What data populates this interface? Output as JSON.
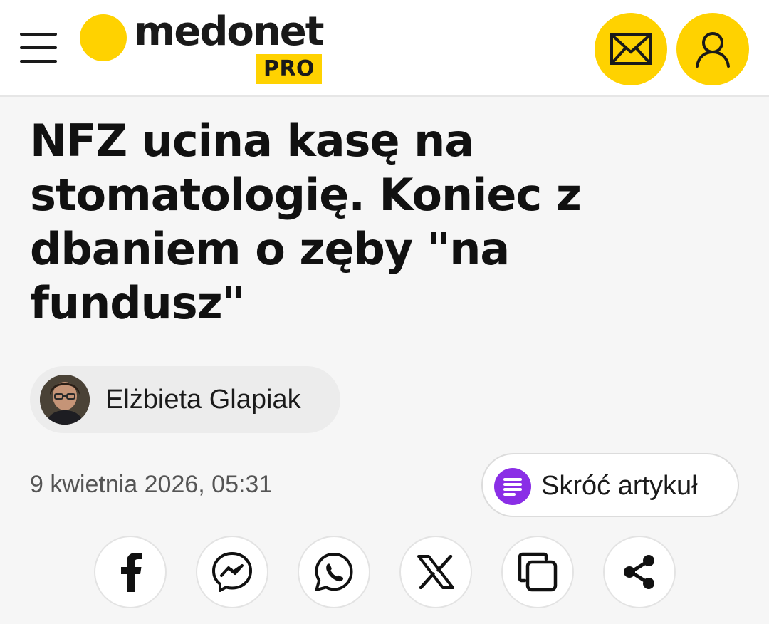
{
  "header": {
    "logo_text": "medonet",
    "logo_badge": "PRO",
    "brand_color": "#ffd200",
    "icons": [
      "hamburger-menu-icon",
      "mail-icon",
      "user-icon"
    ]
  },
  "article": {
    "title": "NFZ ucina kasę na stomatologię. Koniec z dbaniem o zęby \"na fundusz\"",
    "author": "Elżbieta Glapiak",
    "date": "9 kwietnia 2026, 05:31",
    "summarize_label": "Skróć artykuł",
    "summarize_color": "#8a2ee6"
  },
  "share": {
    "icons": [
      "facebook-icon",
      "messenger-icon",
      "whatsapp-icon",
      "x-icon",
      "copy-icon",
      "share-icon"
    ]
  }
}
